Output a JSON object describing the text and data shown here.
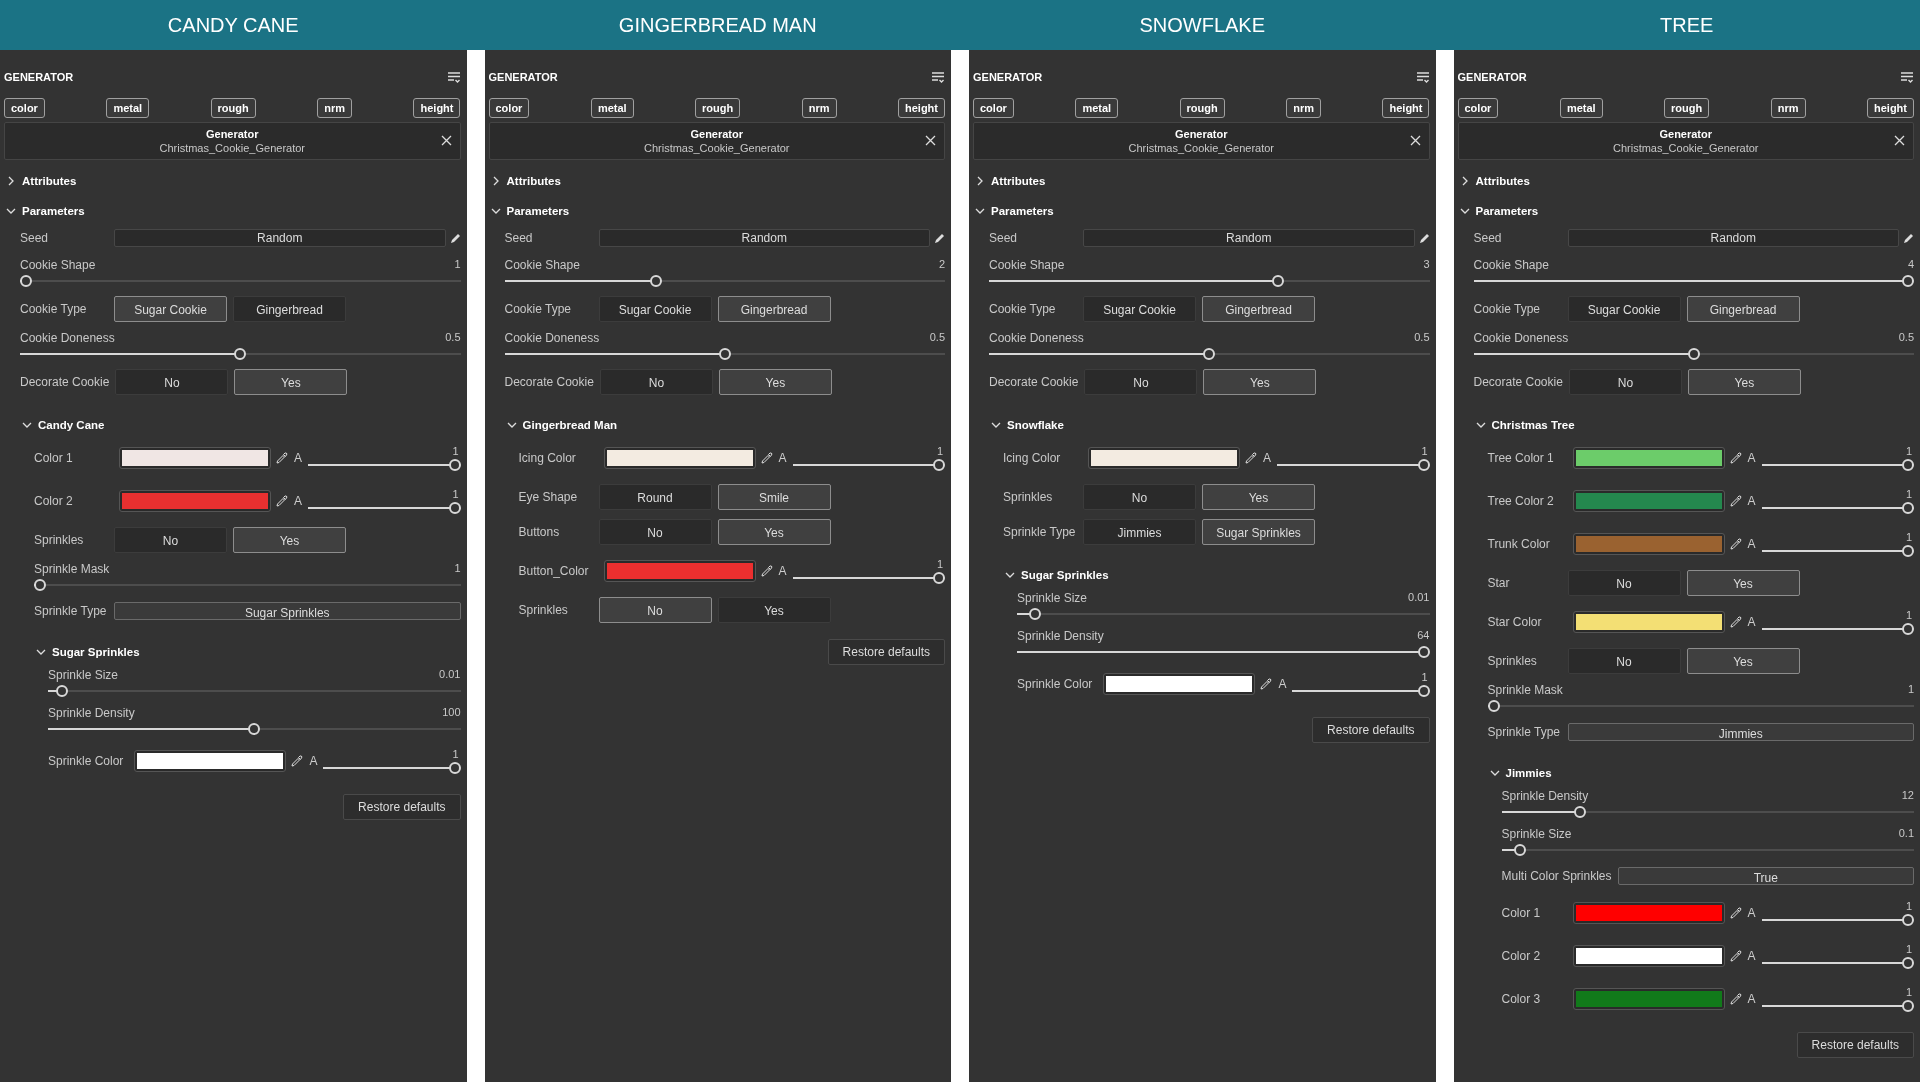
{
  "panels": [
    {
      "title": "CANDY CANE",
      "heading": "GENERATOR",
      "channels": [
        "color",
        "metal",
        "rough",
        "nrm",
        "height"
      ],
      "card": {
        "title": "Generator",
        "subtitle": "Christmas_Cookie_Generator"
      },
      "sections": [
        {
          "title": "Attributes",
          "expanded": false
        },
        {
          "title": "Parameters",
          "expanded": true,
          "children": [
            {
              "kind": "field",
              "label": "Seed",
              "value": "Random"
            },
            {
              "kind": "slider",
              "label": "Cookie Shape",
              "value": "1",
              "level": 0
            },
            {
              "kind": "toggle",
              "label": "Cookie Type",
              "options": [
                {
                  "label": "Sugar Cookie",
                  "selected": true
                },
                {
                  "label": "Gingerbread",
                  "selected": false
                }
              ]
            },
            {
              "kind": "slider",
              "label": "Cookie Doneness",
              "value": "0.5",
              "level": 0.5
            },
            {
              "kind": "toggle",
              "label": "Decorate Cookie",
              "options": [
                {
                  "label": "No",
                  "selected": false
                },
                {
                  "label": "Yes",
                  "selected": true
                }
              ]
            },
            {
              "kind": "group",
              "title": "Candy Cane",
              "expanded": true,
              "children": [
                {
                  "kind": "color",
                  "label": "Color 1",
                  "color": "#f0e6e4",
                  "alpha_label": "A",
                  "alpha": "1",
                  "level": 1
                },
                {
                  "kind": "color",
                  "label": "Color 2",
                  "color": "#e83030",
                  "alpha_label": "A",
                  "alpha": "1",
                  "level": 1
                },
                {
                  "kind": "toggle",
                  "label": "Sprinkles",
                  "options": [
                    {
                      "label": "No",
                      "selected": false
                    },
                    {
                      "label": "Yes",
                      "selected": true
                    }
                  ]
                },
                {
                  "kind": "slider",
                  "label": "Sprinkle Mask",
                  "value": "1",
                  "level": 0
                },
                {
                  "kind": "select",
                  "label": "Sprinkle Type",
                  "value": "Sugar Sprinkles"
                },
                {
                  "kind": "group",
                  "title": "Sugar Sprinkles",
                  "expanded": true,
                  "children": [
                    {
                      "kind": "slider",
                      "label": "Sprinkle Size",
                      "value": "0.01",
                      "level": 0.02
                    },
                    {
                      "kind": "slider",
                      "label": "Sprinkle Density",
                      "value": "100",
                      "level": 0.5
                    },
                    {
                      "kind": "color",
                      "label": "Sprinkle Color",
                      "color": "#ffffff",
                      "alpha_label": "A",
                      "alpha": "1",
                      "level": 1
                    }
                  ]
                }
              ]
            }
          ]
        }
      ],
      "restore": "Restore defaults"
    },
    {
      "title": "GINGERBREAD MAN",
      "heading": "GENERATOR",
      "channels": [
        "color",
        "metal",
        "rough",
        "nrm",
        "height"
      ],
      "card": {
        "title": "Generator",
        "subtitle": "Christmas_Cookie_Generator"
      },
      "sections": [
        {
          "title": "Attributes",
          "expanded": false
        },
        {
          "title": "Parameters",
          "expanded": true,
          "children": [
            {
              "kind": "field",
              "label": "Seed",
              "value": "Random"
            },
            {
              "kind": "slider",
              "label": "Cookie Shape",
              "value": "2",
              "level": 0.34
            },
            {
              "kind": "toggle",
              "label": "Cookie Type",
              "options": [
                {
                  "label": "Sugar Cookie",
                  "selected": false
                },
                {
                  "label": "Gingerbread",
                  "selected": true
                }
              ]
            },
            {
              "kind": "slider",
              "label": "Cookie Doneness",
              "value": "0.5",
              "level": 0.5
            },
            {
              "kind": "toggle",
              "label": "Decorate Cookie",
              "options": [
                {
                  "label": "No",
                  "selected": false
                },
                {
                  "label": "Yes",
                  "selected": true
                }
              ]
            },
            {
              "kind": "group",
              "title": "Gingerbread Man",
              "expanded": true,
              "children": [
                {
                  "kind": "color",
                  "label": "Icing Color",
                  "color": "#f3ebe1",
                  "alpha_label": "A",
                  "alpha": "1",
                  "level": 1
                },
                {
                  "kind": "toggle",
                  "label": "Eye Shape",
                  "options": [
                    {
                      "label": "Round",
                      "selected": false
                    },
                    {
                      "label": "Smile",
                      "selected": true
                    }
                  ]
                },
                {
                  "kind": "toggle",
                  "label": "Buttons",
                  "options": [
                    {
                      "label": "No",
                      "selected": false
                    },
                    {
                      "label": "Yes",
                      "selected": true
                    }
                  ]
                },
                {
                  "kind": "color",
                  "label": "Button_Color",
                  "color": "#ec2f2f",
                  "alpha_label": "A",
                  "alpha": "1",
                  "level": 1
                },
                {
                  "kind": "toggle",
                  "label": "Sprinkles",
                  "options": [
                    {
                      "label": "No",
                      "selected": true
                    },
                    {
                      "label": "Yes",
                      "selected": false
                    }
                  ]
                }
              ]
            }
          ]
        }
      ],
      "restore": "Restore defaults"
    },
    {
      "title": "SNOWFLAKE",
      "heading": "GENERATOR",
      "channels": [
        "color",
        "metal",
        "rough",
        "nrm",
        "height"
      ],
      "card": {
        "title": "Generator",
        "subtitle": "Christmas_Cookie_Generator"
      },
      "sections": [
        {
          "title": "Attributes",
          "expanded": false
        },
        {
          "title": "Parameters",
          "expanded": true,
          "children": [
            {
              "kind": "field",
              "label": "Seed",
              "value": "Random"
            },
            {
              "kind": "slider",
              "label": "Cookie Shape",
              "value": "3",
              "level": 0.66
            },
            {
              "kind": "toggle",
              "label": "Cookie Type",
              "options": [
                {
                  "label": "Sugar Cookie",
                  "selected": false
                },
                {
                  "label": "Gingerbread",
                  "selected": true
                }
              ]
            },
            {
              "kind": "slider",
              "label": "Cookie Doneness",
              "value": "0.5",
              "level": 0.5
            },
            {
              "kind": "toggle",
              "label": "Decorate Cookie",
              "options": [
                {
                  "label": "No",
                  "selected": false
                },
                {
                  "label": "Yes",
                  "selected": true
                }
              ]
            },
            {
              "kind": "group",
              "title": "Snowflake",
              "expanded": true,
              "children": [
                {
                  "kind": "color",
                  "label": "Icing Color",
                  "color": "#f3ebe1",
                  "alpha_label": "A",
                  "alpha": "1",
                  "level": 1
                },
                {
                  "kind": "toggle",
                  "label": "Sprinkles",
                  "options": [
                    {
                      "label": "No",
                      "selected": false
                    },
                    {
                      "label": "Yes",
                      "selected": true
                    }
                  ]
                },
                {
                  "kind": "toggle",
                  "label": "Sprinkle Type",
                  "options": [
                    {
                      "label": "Jimmies",
                      "selected": false
                    },
                    {
                      "label": "Sugar Sprinkles",
                      "selected": true
                    }
                  ]
                },
                {
                  "kind": "group",
                  "title": "Sugar Sprinkles",
                  "expanded": true,
                  "children": [
                    {
                      "kind": "slider",
                      "label": "Sprinkle Size",
                      "value": "0.01",
                      "level": 0.03
                    },
                    {
                      "kind": "slider",
                      "label": "Sprinkle Density",
                      "value": "64",
                      "level": 1
                    },
                    {
                      "kind": "color",
                      "label": "Sprinkle Color",
                      "color": "#ffffff",
                      "alpha_label": "A",
                      "alpha": "1",
                      "level": 1
                    }
                  ]
                }
              ]
            }
          ]
        }
      ],
      "restore": "Restore defaults"
    },
    {
      "title": "TREE",
      "heading": "GENERATOR",
      "channels": [
        "color",
        "metal",
        "rough",
        "nrm",
        "height"
      ],
      "card": {
        "title": "Generator",
        "subtitle": "Christmas_Cookie_Generator"
      },
      "sections": [
        {
          "title": "Attributes",
          "expanded": false
        },
        {
          "title": "Parameters",
          "expanded": true,
          "children": [
            {
              "kind": "field",
              "label": "Seed",
              "value": "Random"
            },
            {
              "kind": "slider",
              "label": "Cookie Shape",
              "value": "4",
              "level": 1
            },
            {
              "kind": "toggle",
              "label": "Cookie Type",
              "options": [
                {
                  "label": "Sugar Cookie",
                  "selected": false
                },
                {
                  "label": "Gingerbread",
                  "selected": true
                }
              ]
            },
            {
              "kind": "slider",
              "label": "Cookie Doneness",
              "value": "0.5",
              "level": 0.5
            },
            {
              "kind": "toggle",
              "label": "Decorate Cookie",
              "options": [
                {
                  "label": "No",
                  "selected": false
                },
                {
                  "label": "Yes",
                  "selected": true
                }
              ]
            },
            {
              "kind": "group",
              "title": "Christmas Tree",
              "expanded": true,
              "children": [
                {
                  "kind": "color",
                  "label": "Tree Color 1",
                  "color": "#6ccc6a",
                  "alpha_label": "A",
                  "alpha": "1",
                  "level": 1
                },
                {
                  "kind": "color",
                  "label": "Tree Color 2",
                  "color": "#24884e",
                  "alpha_label": "A",
                  "alpha": "1",
                  "level": 1
                },
                {
                  "kind": "color",
                  "label": "Trunk Color",
                  "color": "#9a6230",
                  "alpha_label": "A",
                  "alpha": "1",
                  "level": 1
                },
                {
                  "kind": "toggle",
                  "label": "Star",
                  "options": [
                    {
                      "label": "No",
                      "selected": false
                    },
                    {
                      "label": "Yes",
                      "selected": true
                    }
                  ]
                },
                {
                  "kind": "color",
                  "label": "Star Color",
                  "color": "#f3df74",
                  "alpha_label": "A",
                  "alpha": "1",
                  "level": 1
                },
                {
                  "kind": "toggle",
                  "label": "Sprinkles",
                  "options": [
                    {
                      "label": "No",
                      "selected": false
                    },
                    {
                      "label": "Yes",
                      "selected": true
                    }
                  ]
                },
                {
                  "kind": "slider",
                  "label": "Sprinkle Mask",
                  "value": "1",
                  "level": 0
                },
                {
                  "kind": "select",
                  "label": "Sprinkle Type",
                  "value": "Jimmies"
                },
                {
                  "kind": "group",
                  "title": "Jimmies",
                  "expanded": true,
                  "children": [
                    {
                      "kind": "slider",
                      "label": "Sprinkle Density",
                      "value": "12",
                      "level": 0.18
                    },
                    {
                      "kind": "slider",
                      "label": "Sprinkle Size",
                      "value": "0.1",
                      "level": 0.03
                    },
                    {
                      "kind": "select",
                      "label": "Multi Color Sprinkles",
                      "value": "True"
                    },
                    {
                      "kind": "color",
                      "label": "Color 1",
                      "color": "#ff0000",
                      "alpha_label": "A",
                      "alpha": "1",
                      "level": 1
                    },
                    {
                      "kind": "color",
                      "label": "Color 2",
                      "color": "#ffffff",
                      "alpha_label": "A",
                      "alpha": "1",
                      "level": 1
                    },
                    {
                      "kind": "color",
                      "label": "Color 3",
                      "color": "#117a1a",
                      "alpha_label": "A",
                      "alpha": "1",
                      "level": 1
                    }
                  ]
                }
              ]
            }
          ]
        }
      ],
      "restore": "Restore defaults"
    }
  ]
}
